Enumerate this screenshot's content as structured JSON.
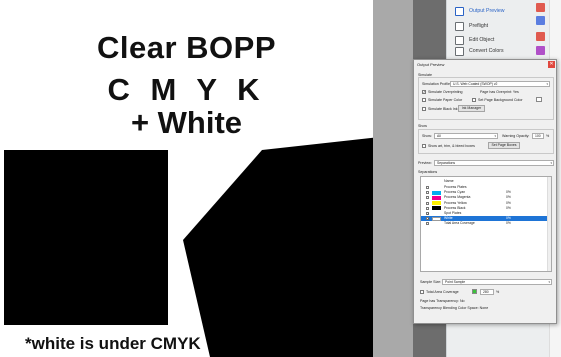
{
  "document": {
    "line1": "Clear BOPP",
    "line2": "C M Y K",
    "line3": "+ White",
    "footnote": "*white is under CMYK"
  },
  "tools": [
    {
      "label": "Output Preview",
      "icon": "output-preview-icon",
      "active": true
    },
    {
      "label": "Preflight",
      "icon": "preflight-icon",
      "active": false
    },
    {
      "label": "Edit Object",
      "icon": "edit-object-icon",
      "active": false
    },
    {
      "label": "Convert Colors",
      "icon": "convert-colors-icon",
      "active": false
    }
  ],
  "dialog": {
    "title": "Output Preview",
    "simulate_group": "Simulate",
    "simulation_profile_label": "Simulation Profile:",
    "simulation_profile_value": "U.S. Web Coated (SWOP) v2",
    "simulate_overprinting_label": "Simulate Overprinting",
    "page_has_overprint": "Page has Overprint: Yes",
    "simulate_paper_color_label": "Simulate Paper Color",
    "set_page_bg_label": "Set Page Background Color",
    "simulate_black_ink_label": "Simulate Black Ink",
    "ink_manager_label": "Ink Manager",
    "show_group": "Show",
    "show_label": "Show:",
    "show_value": "All",
    "warning_opacity_label": "Warning Opacity:",
    "warning_opacity_value": "100",
    "percent": "%",
    "show_art_trim_label": "Show art, trim, & bleed boxes",
    "set_page_boxes_label": "Set Page Boxes",
    "preview_label": "Preview:",
    "preview_value": "Separations",
    "separations_label": "Separations",
    "list_header": "Name",
    "separations": [
      {
        "name": "Process Plates",
        "color": "",
        "pct": "",
        "checked": false,
        "selected": false
      },
      {
        "name": "Process Cyan",
        "color": "#00aeef",
        "pct": "0%",
        "checked": false,
        "selected": false
      },
      {
        "name": "Process Magenta",
        "color": "#ec008c",
        "pct": "0%",
        "checked": false,
        "selected": false
      },
      {
        "name": "Process Yellow",
        "color": "#fff200",
        "pct": "0%",
        "checked": false,
        "selected": false
      },
      {
        "name": "Process Black",
        "color": "#000000",
        "pct": "0%",
        "checked": false,
        "selected": false
      },
      {
        "name": "Spot Plates",
        "color": "",
        "pct": "",
        "checked": true,
        "selected": false
      },
      {
        "name": "White",
        "color": "#ffffff",
        "pct": "0%",
        "checked": true,
        "selected": true
      },
      {
        "name": "Total Area Coverage",
        "color": "",
        "pct": "0%",
        "checked": false,
        "selected": false
      }
    ],
    "sample_size_label": "Sample Size:",
    "sample_size_value": "Point Sample",
    "total_area_coverage_label": "Total Area Coverage",
    "tac_value": "280",
    "page_has_transparency": "Page has Transparency: No",
    "transparency_blending": "Transparency Blending Color Space: None"
  },
  "colors": {
    "accent": "#2a63c6",
    "selection": "#1e74d6",
    "tac_swatch": "#3cc13c",
    "close": "#e0483e"
  }
}
